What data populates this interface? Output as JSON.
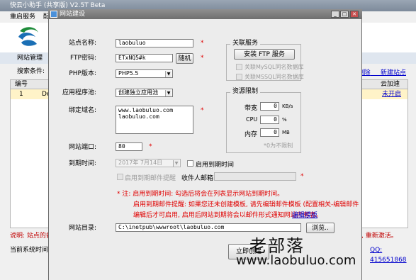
{
  "background_window": {
    "title": "快云小助手 (共享版) V2.5T Beta",
    "menu": [
      "重启服务",
      "配置"
    ],
    "tab": "网站管理",
    "search_label": "搜索条件:",
    "grid_headers": [
      "编号",
      "",
      "云加速"
    ],
    "row": {
      "id": "1",
      "name": "Det",
      "status": "未开启"
    },
    "right_links": [
      "删除",
      "新建站点"
    ],
    "note": "说明: 站点的备份",
    "note_right": "点击保存, 重新激活。",
    "status_left": "当前系统时间: 2",
    "status_right": "QQ: 415651868"
  },
  "dialog": {
    "title": "网站建设",
    "fields": {
      "site_name_label": "站点名称:",
      "site_name_value": "laobuluo",
      "ftp_password_label": "FTP密码:",
      "ftp_password_value": "ETxNQ5#k",
      "random_button": "随机",
      "php_version_label": "PHP版本:",
      "php_version_value": "PHP5.5",
      "app_pool_label": "应用程序池:",
      "app_pool_value": "创建独立应用池",
      "bind_domain_label": "绑定域名:",
      "bind_domain_lines": [
        "www.laobuluo.com",
        "laobuluo.com"
      ],
      "port_label": "网站端口:",
      "port_value": "80",
      "expire_label": "到期时间:",
      "expire_value": "2017年 7月14日",
      "expire_checkbox_label": "启用到期时间",
      "mail_remind_label": "启用到期邮件提醒",
      "receiver_label": "收件人邮箱:",
      "site_dir_label": "网站目录:",
      "site_dir_value": "C:\\inetpub\\wwwroot\\laobuluo.com",
      "browse_button": "浏览..",
      "create_button": "立即创建"
    },
    "related_service": {
      "title": "关联服务",
      "install_ftp": "安装 FTP 服务",
      "mysql_check": "关联MySQL同名数据库",
      "mssql_check": "关联MSSQL同名数据库"
    },
    "resource_limit": {
      "title": "资源限制",
      "bandwidth_label": "带宽",
      "bandwidth_value": "0",
      "bandwidth_unit": "KB/s",
      "cpu_label": "CPU",
      "cpu_value": "0",
      "cpu_unit": "%",
      "memory_label": "内存",
      "memory_value": "0",
      "memory_unit": "MB",
      "hint": "*0为不限制"
    },
    "notes": {
      "line1": "* 注: 启用到期时间: 勾选后将会在列表显示网站到期时间。",
      "line2": "启用到期邮件提醒: 如果您还未创建模板, 请先编辑邮件模板 (配置相关-编辑邮件模板),",
      "line3": "编辑后才可启用, 启用后网站到期将会以邮件形式通知网站所有者。",
      "edit_template_link": "编辑模板"
    }
  },
  "watermark": {
    "cn": "老部落",
    "url": "www.laobuluo.com"
  },
  "colors": {
    "required": "#e00000",
    "link": "#0000cc",
    "dialog_bg": "#ececec"
  }
}
